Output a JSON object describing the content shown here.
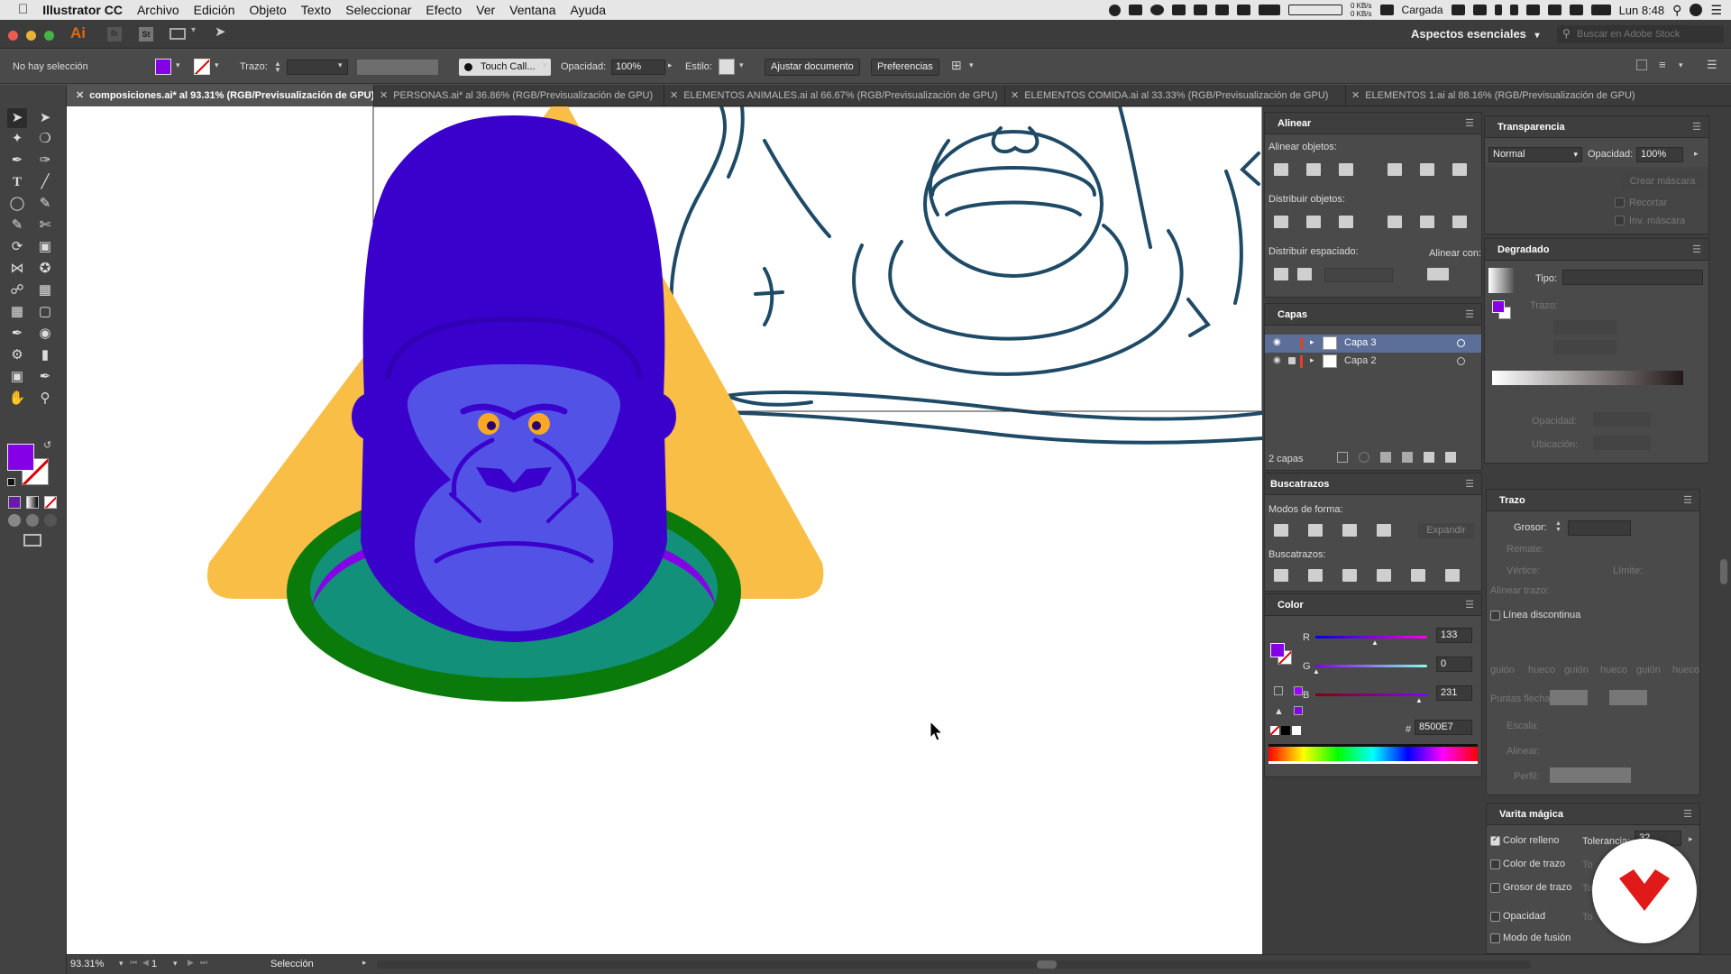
{
  "menubar": {
    "app": "Illustrator CC",
    "items": [
      "Archivo",
      "Edición",
      "Objeto",
      "Texto",
      "Seleccionar",
      "Efecto",
      "Ver",
      "Ventana",
      "Ayuda"
    ],
    "net": "0 KB/s\n0 KB/s",
    "battery": "Cargada",
    "clock": "Lun 8:48"
  },
  "titlebar": {
    "ai_logo": "Ai",
    "br_logo": "Br",
    "st_logo": "St",
    "workspace": "Aspectos esenciales",
    "search_placeholder": "Buscar en Adobe Stock"
  },
  "controlbar": {
    "selection": "No hay selección",
    "fill_color": "#8500E7",
    "stroke_label": "Trazo:",
    "brush": "Touch Call...",
    "opacity_label": "Opacidad:",
    "opacity_value": "100%",
    "style_label": "Estilo:",
    "ajustar": "Ajustar documento",
    "preferencias": "Preferencias"
  },
  "tabs": [
    {
      "label": "composiciones.ai* al 93.31% (RGB/Previsualización de GPU)",
      "active": true
    },
    {
      "label": "PERSONAS.ai* al 36.86% (RGB/Previsualización de GPU)",
      "active": false
    },
    {
      "label": "ELEMENTOS ANIMALES.ai al 66.67% (RGB/Previsualización de GPU)",
      "active": false
    },
    {
      "label": "ELEMENTOS COMIDA.ai al 33.33% (RGB/Previsualización de GPU)",
      "active": false
    },
    {
      "label": "ELEMENTOS 1.ai al 88.16% (RGB/Previsualización de GPU)",
      "active": false
    }
  ],
  "artwork": {
    "triangle": "#F9BE45",
    "gorilla_dark": "#3A00CC",
    "gorilla_face": "#5252E6",
    "ring": "#0A7A0A",
    "platform": "#12907A",
    "purple": "#8500E7",
    "eyes": "#F9A825",
    "sketch": "#1E4A66"
  },
  "align_panel": {
    "title": "Alinear",
    "align_objects": "Alinear objetos:",
    "distribute_objects": "Distribuir objetos:",
    "distribute_spacing": "Distribuir espaciado:",
    "align_to": "Alinear con:"
  },
  "layers_panel": {
    "title": "Capas",
    "layers": [
      {
        "name": "Capa 3",
        "color": "#E0402A",
        "selected": true
      },
      {
        "name": "Capa 2",
        "color": "#E0402A",
        "selected": false
      }
    ],
    "count": "2 capas"
  },
  "pathfinder_panel": {
    "title": "Buscatrazos",
    "shape_modes": "Modos de forma:",
    "expand": "Expandir",
    "pathfinders": "Buscatrazos:"
  },
  "color_panel": {
    "title": "Color",
    "r_label": "R",
    "r_value": "133",
    "g_label": "G",
    "g_value": "0",
    "b_label": "B",
    "b_value": "231",
    "hash": "#",
    "hex": "8500E7"
  },
  "transparency_panel": {
    "title": "Transparencia",
    "mode": "Normal",
    "opacity_label": "Opacidad:",
    "opacity_value": "100%",
    "make_mask": "Crear máscara",
    "clip": "Recortar",
    "invert": "Inv. máscara"
  },
  "gradient_panel": {
    "title": "Degradado",
    "type_label": "Tipo:",
    "stroke_label": "Trazo:",
    "opacity_label": "Opacidad:",
    "location_label": "Ubicación:"
  },
  "stroke_panel": {
    "title": "Trazo",
    "weight": "Grosor:",
    "cap": "Remate:",
    "corner": "Vértice:",
    "limit": "Límite:",
    "align": "Alinear trazo:",
    "dashed": "Línea discontinua",
    "dash_labels": [
      "guión",
      "hueco",
      "guión",
      "hueco",
      "guión",
      "hueco"
    ],
    "arrowheads": "Puntas flecha:",
    "scale": "Escala:",
    "align2": "Alinear:",
    "profile": "Perfil:"
  },
  "magic_wand_panel": {
    "title": "Varita mágica",
    "fill_color": "Color relleno",
    "tolerance_label": "Tolerancia:",
    "tolerance_value": "32",
    "stroke_color": "Color de trazo",
    "stroke_weight": "Grosor de trazo",
    "opacity": "Opacidad",
    "blend_mode": "Modo de fusión",
    "tol_short": "To"
  },
  "statusbar": {
    "zoom": "93.31%",
    "artboard": "1",
    "mode": "Selección"
  },
  "touchbar": {
    "keys": [
      "⇧",
      "⌃",
      "⌥",
      "⌘"
    ]
  }
}
